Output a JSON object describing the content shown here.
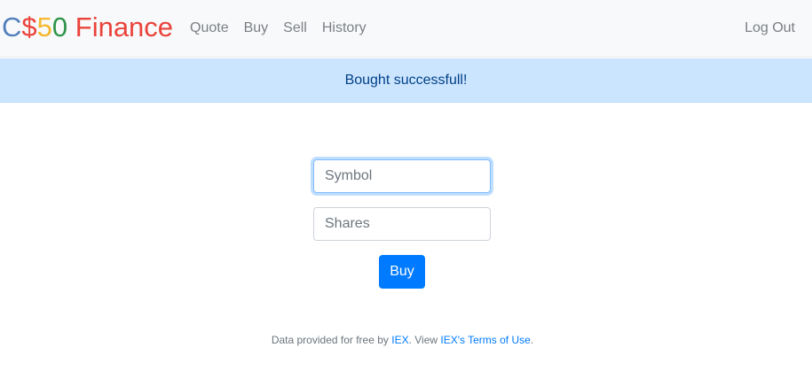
{
  "navbar": {
    "brand": {
      "parts": [
        {
          "text": "C",
          "color": "#537fbe"
        },
        {
          "text": "$",
          "color": "#ea433b"
        },
        {
          "text": "5",
          "color": "#f5b82e"
        },
        {
          "text": "0",
          "color": "#2e944b"
        },
        {
          "text": " Finance",
          "color": "#ea433b"
        }
      ]
    },
    "links": [
      "Quote",
      "Buy",
      "Sell",
      "History"
    ],
    "logout": "Log Out"
  },
  "alert": {
    "message": "Bought successfull!"
  },
  "form": {
    "symbol_placeholder": "Symbol",
    "symbol_value": "",
    "shares_placeholder": "Shares",
    "shares_value": "",
    "submit_label": "Buy"
  },
  "footer": {
    "text_before": "Data provided for free by ",
    "iex_link": "IEX",
    "text_middle": ". View ",
    "terms_link": "IEX's Terms of Use",
    "text_after": "."
  }
}
